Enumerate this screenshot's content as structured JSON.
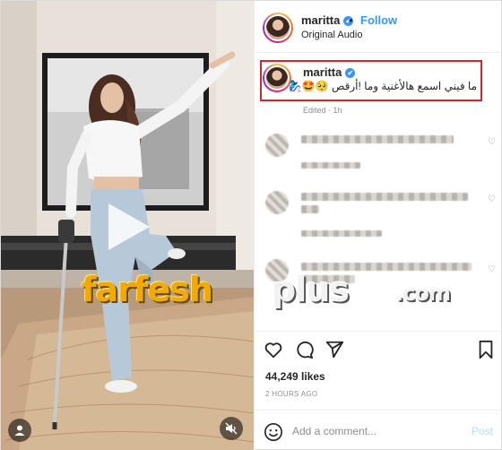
{
  "post": {
    "username": "maritta",
    "follow_label": "Follow",
    "separator": "•",
    "audio": "Original Audio",
    "caption": {
      "username": "maritta",
      "text": "ما فيني اسمع هالأغنية وما",
      "text_tail": "أرقص!",
      "emojis": "🧞‍♀️🤩🥺"
    },
    "edited": "Edited · 1h",
    "likes": "44,249 likes",
    "time_ago": "2 HOURS AGO"
  },
  "comment_box": {
    "placeholder": "Add a comment...",
    "post_label": "Post"
  },
  "watermark": {
    "part1": "farfesh",
    "part2": "plus",
    "part3": ".com"
  },
  "icons": {
    "verified": "✔",
    "heart_small": "♡"
  },
  "colors": {
    "accent": "#3897f0",
    "highlight_border": "#d0282e",
    "post_disabled": "#b2dffc",
    "watermark_orange": "#f2a900"
  }
}
